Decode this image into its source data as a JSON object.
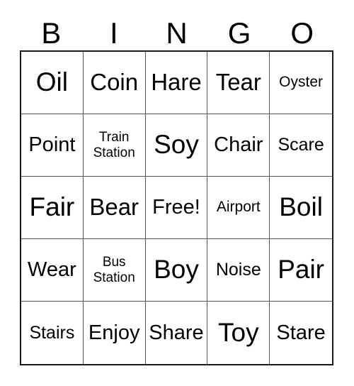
{
  "card": {
    "header_letters": [
      "B",
      "I",
      "N",
      "G",
      "O"
    ],
    "columns": 5,
    "rows": 5,
    "free_space_label": "Free!",
    "free_space_position": {
      "row": 3,
      "column": 3
    },
    "border_color": "#1a1a1a",
    "grid_line_color": "#555555",
    "background_color": "#ffffff",
    "text_color": "#000000",
    "cells": [
      {
        "label": "Oil",
        "size": "fs-xl",
        "row": 1,
        "column": 1
      },
      {
        "label": "Coin",
        "size": "fs-lg",
        "row": 1,
        "column": 2
      },
      {
        "label": "Hare",
        "size": "fs-lg",
        "row": 1,
        "column": 3
      },
      {
        "label": "Tear",
        "size": "fs-lg",
        "row": 1,
        "column": 4
      },
      {
        "label": "Oyster",
        "size": "fs-xs",
        "row": 1,
        "column": 5
      },
      {
        "label": "Point",
        "size": "fs-md",
        "row": 2,
        "column": 1
      },
      {
        "label": "Train\nStation",
        "size": "fs-xxs",
        "row": 2,
        "column": 2
      },
      {
        "label": "Soy",
        "size": "fs-xl",
        "row": 2,
        "column": 3
      },
      {
        "label": "Chair",
        "size": "fs-md",
        "row": 2,
        "column": 4
      },
      {
        "label": "Scare",
        "size": "fs-sm",
        "row": 2,
        "column": 5
      },
      {
        "label": "Fair",
        "size": "fs-xl",
        "row": 3,
        "column": 1
      },
      {
        "label": "Bear",
        "size": "fs-lg",
        "row": 3,
        "column": 2
      },
      {
        "label": "Free!",
        "size": "fs-md",
        "row": 3,
        "column": 3
      },
      {
        "label": "Airport",
        "size": "fs-xs",
        "row": 3,
        "column": 4
      },
      {
        "label": "Boil",
        "size": "fs-xl",
        "row": 3,
        "column": 5
      },
      {
        "label": "Wear",
        "size": "fs-md",
        "row": 4,
        "column": 1
      },
      {
        "label": "Bus\nStation",
        "size": "fs-xxs",
        "row": 4,
        "column": 2
      },
      {
        "label": "Boy",
        "size": "fs-xl",
        "row": 4,
        "column": 3
      },
      {
        "label": "Noise",
        "size": "fs-sm",
        "row": 4,
        "column": 4
      },
      {
        "label": "Pair",
        "size": "fs-xl",
        "row": 4,
        "column": 5
      },
      {
        "label": "Stairs",
        "size": "fs-sm",
        "row": 5,
        "column": 1
      },
      {
        "label": "Enjoy",
        "size": "fs-md",
        "row": 5,
        "column": 2
      },
      {
        "label": "Share",
        "size": "fs-md",
        "row": 5,
        "column": 3
      },
      {
        "label": "Toy",
        "size": "fs-xl",
        "row": 5,
        "column": 4
      },
      {
        "label": "Stare",
        "size": "fs-md",
        "row": 5,
        "column": 5
      }
    ]
  }
}
